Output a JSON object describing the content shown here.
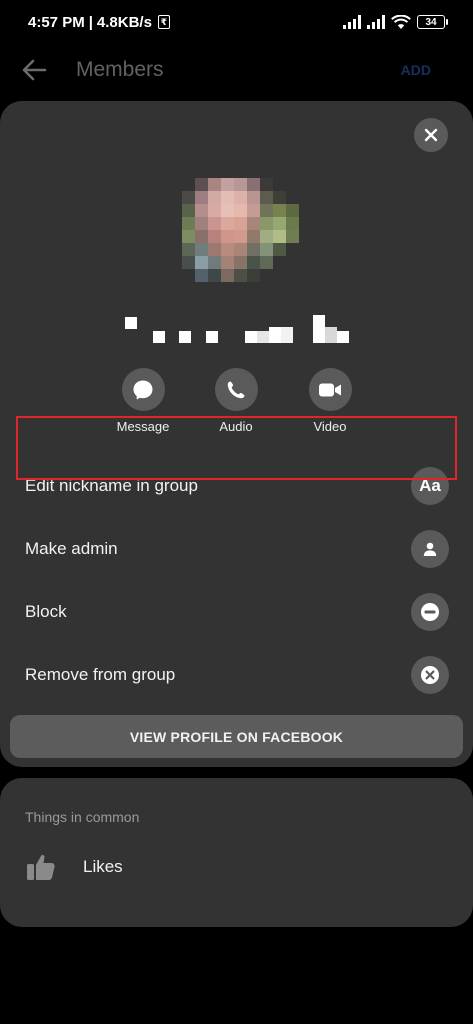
{
  "status_bar": {
    "time": "4:57 PM",
    "separator": "|",
    "network_speed": "4.8KB/s",
    "battery_level": "34",
    "icons": [
      "rupee-icon",
      "signal-icon",
      "signal-icon",
      "wifi-icon",
      "battery-icon"
    ]
  },
  "app_bar": {
    "title": "Members",
    "add_label": "ADD"
  },
  "sheet": {
    "actions": [
      {
        "label": "Message",
        "icon": "messenger-icon"
      },
      {
        "label": "Audio",
        "icon": "phone-icon"
      },
      {
        "label": "Video",
        "icon": "video-camera-icon"
      }
    ],
    "menu": [
      {
        "label": "Edit nickname in group",
        "icon_text": "Aa",
        "icon": "text-icon"
      },
      {
        "label": "Make admin",
        "icon": "person-icon",
        "highlighted": true
      },
      {
        "label": "Block",
        "icon": "block-icon"
      },
      {
        "label": "Remove from group",
        "icon": "remove-icon"
      }
    ],
    "view_profile_label": "VIEW PROFILE ON FACEBOOK"
  },
  "common": {
    "heading": "Things in common",
    "likes_label": "Likes"
  },
  "colors": {
    "background": "#000000",
    "sheet": "#333333",
    "icon_circle": "#5a5a5a",
    "highlight_border": "#e0252b",
    "add_link": "#3a6fd8"
  }
}
